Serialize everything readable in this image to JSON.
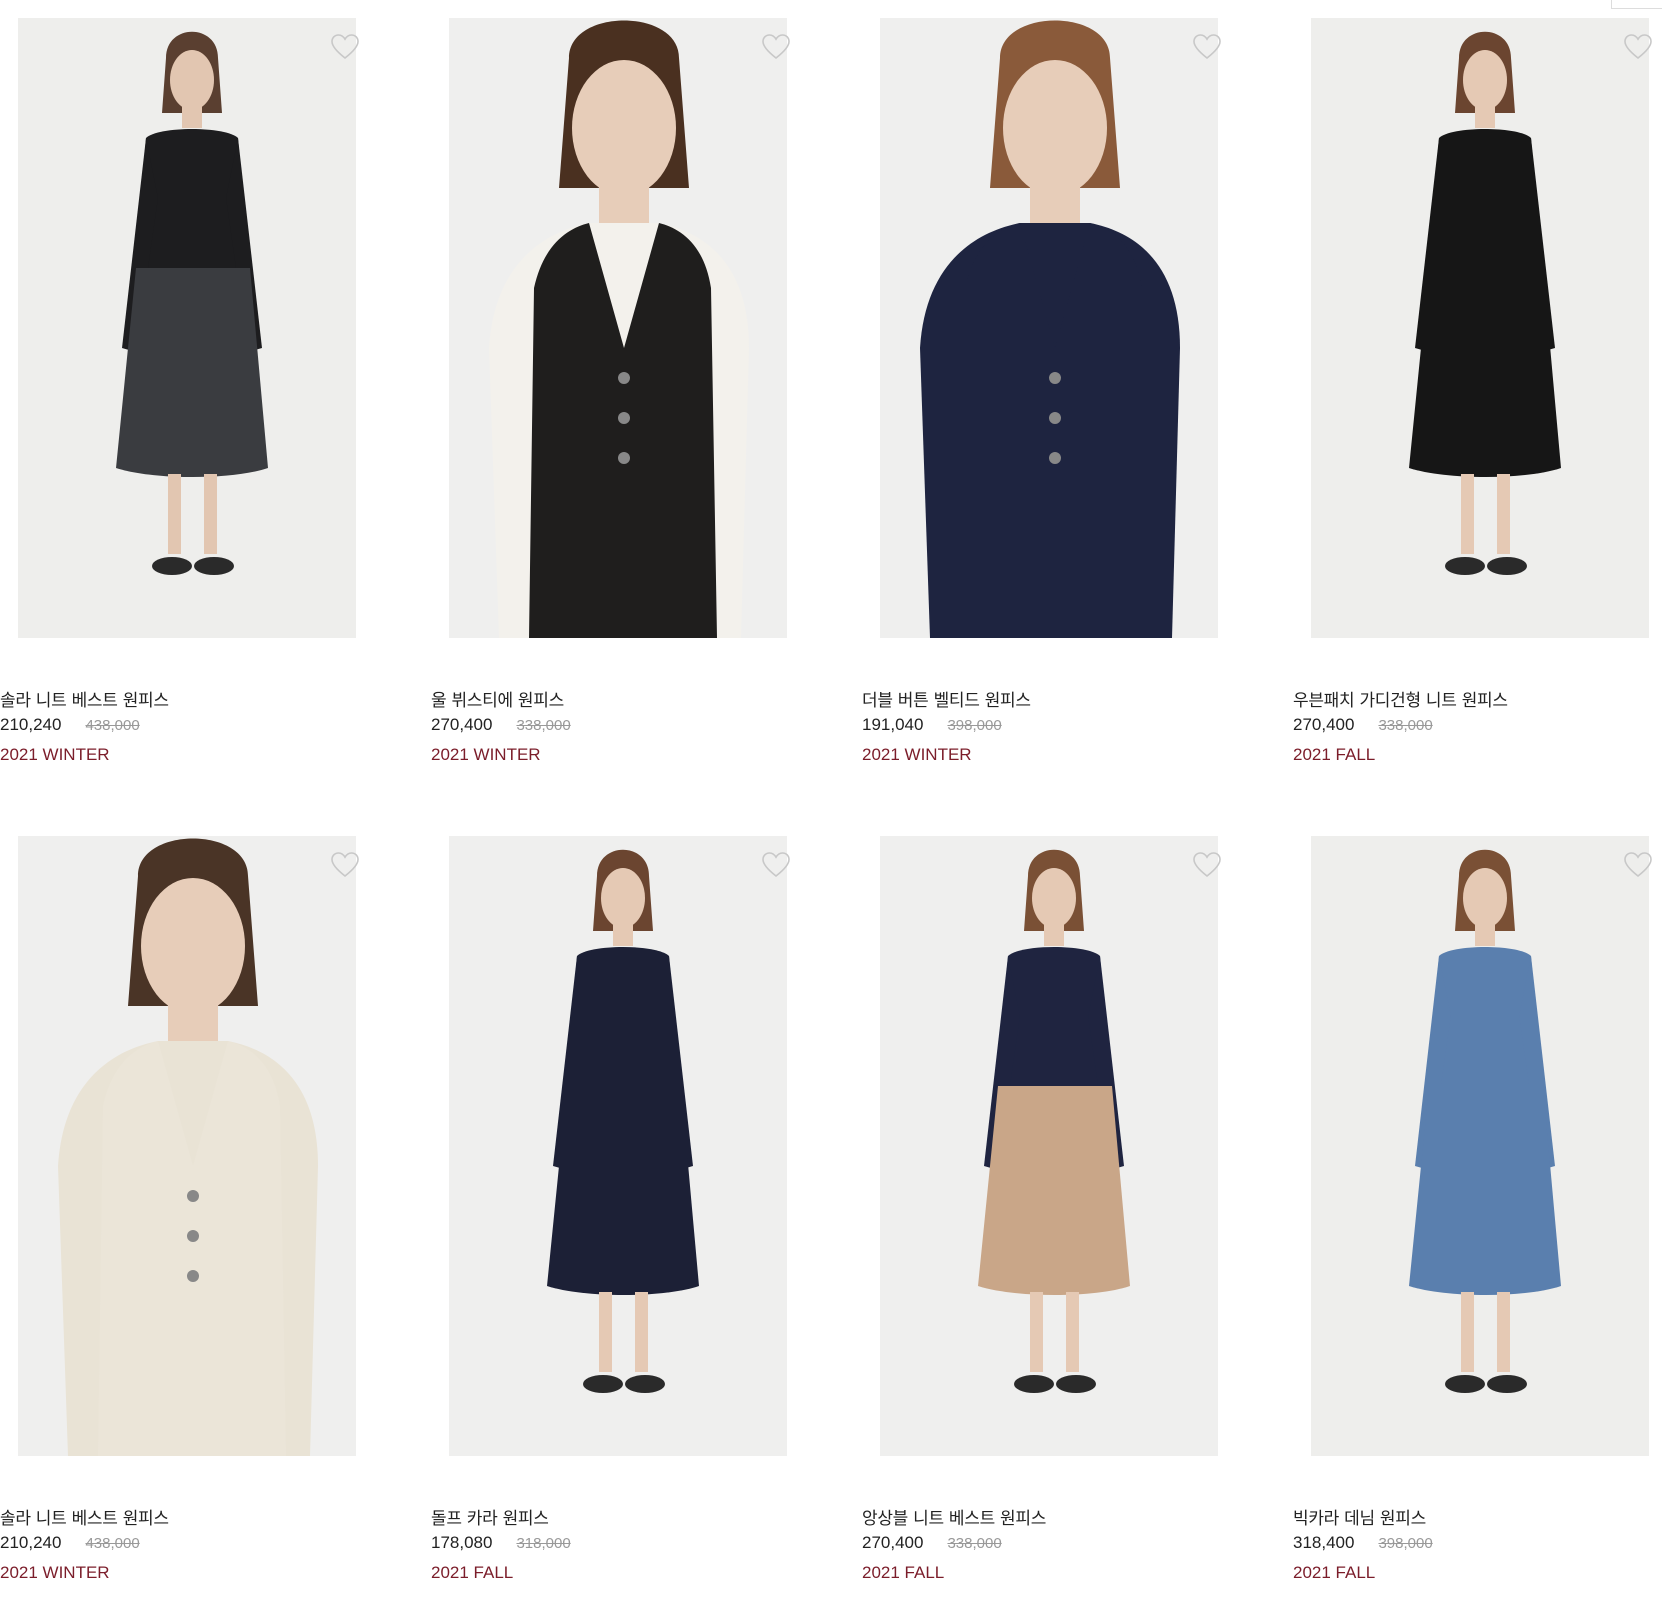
{
  "colors": {
    "season_text": "#7b1d2a",
    "original_price": "#999999",
    "text": "#222222"
  },
  "products": [
    {
      "name": "솔라 니트 베스트 원피스",
      "price": "210,240",
      "original_price": "438,000",
      "season": "2021 WINTER",
      "image": {
        "bg": "#eeeeec",
        "outfit": "#3a3c40",
        "top": "#1d1d1f",
        "skin": "#e2c6b1",
        "hair": "#5a3f30",
        "view": "full"
      }
    },
    {
      "name": "울 뷔스티에 원피스",
      "price": "270,400",
      "original_price": "338,000",
      "season": "2021 WINTER",
      "image": {
        "bg": "#efefee",
        "outfit": "#1f1e1d",
        "top": "#f3f1ec",
        "skin": "#e7cdb9",
        "hair": "#4a3020",
        "view": "close"
      }
    },
    {
      "name": "더블 버튼 벨티드 원피스",
      "price": "191,040",
      "original_price": "398,000",
      "season": "2021 WINTER",
      "image": {
        "bg": "#efefee",
        "outfit": "#1e2440",
        "top": "#1e2440",
        "skin": "#e7cdb9",
        "hair": "#8a5a3a",
        "view": "close"
      }
    },
    {
      "name": "우븐패치 가디건형 니트 원피스",
      "price": "270,400",
      "original_price": "338,000",
      "season": "2021 FALL",
      "image": {
        "bg": "#eeeeec",
        "outfit": "#161616",
        "top": "#161616",
        "skin": "#e5c9b4",
        "hair": "#6b4530",
        "view": "full"
      }
    },
    {
      "name": "솔라 니트 베스트 원피스",
      "price": "210,240",
      "original_price": "438,000",
      "season": "2021 WINTER",
      "image": {
        "bg": "#efefee",
        "outfit": "#ebe5d8",
        "top": "#e9e3d5",
        "skin": "#e7cdb9",
        "hair": "#4a3426",
        "view": "close"
      }
    },
    {
      "name": "돌프 카라 원피스",
      "price": "178,080",
      "original_price": "318,000",
      "season": "2021 FALL",
      "image": {
        "bg": "#efefee",
        "outfit": "#1c2036",
        "top": "#1c2036",
        "skin": "#e5c9b4",
        "hair": "#6b4530",
        "view": "full"
      }
    },
    {
      "name": "앙상블 니트 베스트 원피스",
      "price": "270,400",
      "original_price": "338,000",
      "season": "2021 FALL",
      "image": {
        "bg": "#efefee",
        "outfit": "#c9a688",
        "top": "#1f2440",
        "skin": "#e5c9b4",
        "hair": "#7a5035",
        "view": "full"
      }
    },
    {
      "name": "빅카라 데님 원피스",
      "price": "318,400",
      "original_price": "398,000",
      "season": "2021 FALL",
      "image": {
        "bg": "#eeeeec",
        "outfit": "#5a7fae",
        "top": "#5a7fae",
        "skin": "#e5c9b4",
        "hair": "#7a5035",
        "view": "full"
      }
    }
  ],
  "icons": {
    "wishlist": "heart-outline-icon"
  }
}
